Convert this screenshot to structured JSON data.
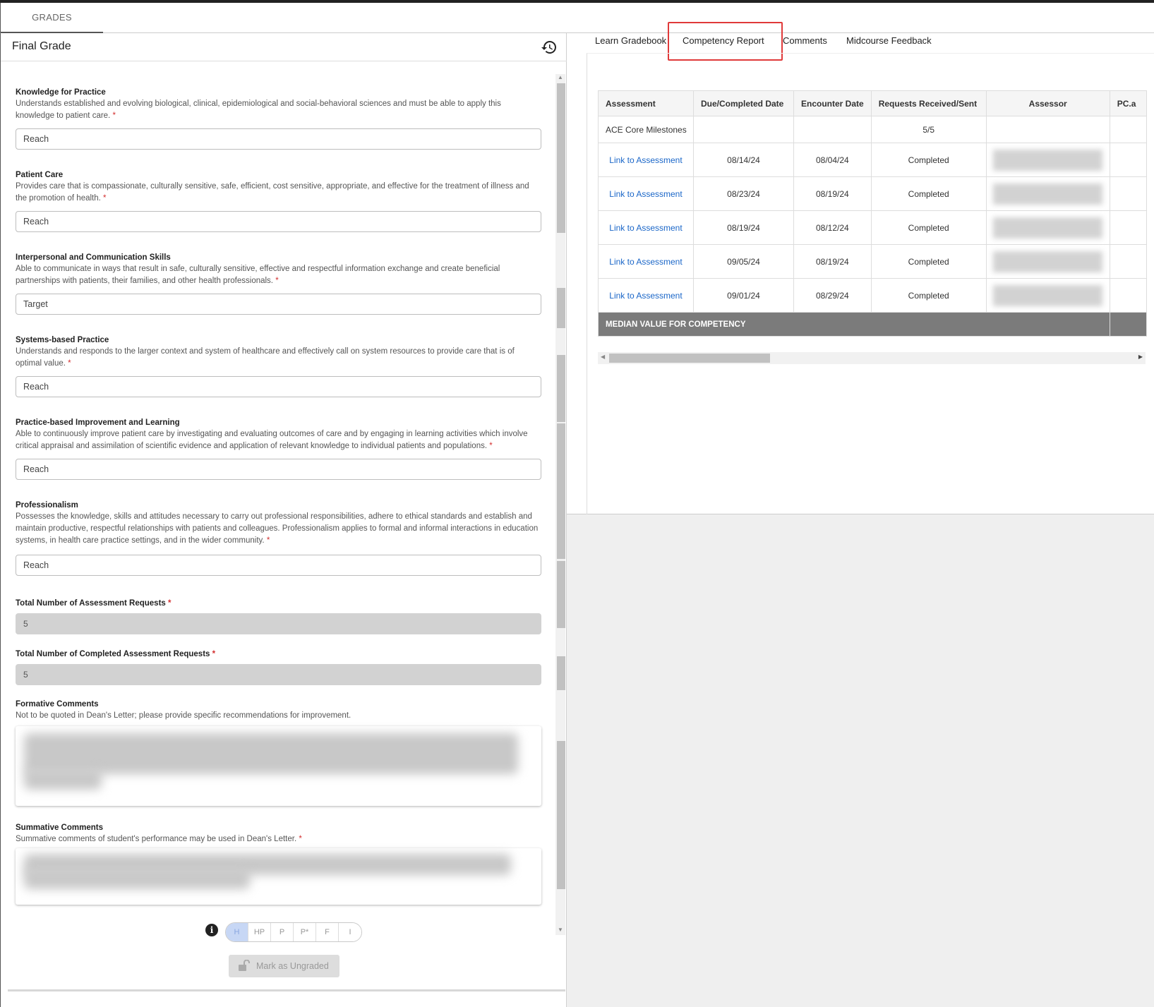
{
  "tabs": {
    "grades": "GRADES"
  },
  "final_grade": {
    "title": "Final Grade",
    "competencies": [
      {
        "label": "Knowledge for Practice",
        "description": "Understands established and evolving biological, clinical, epidemiological and social-behavioral sciences and must be able to apply this knowledge to patient care.",
        "value": "Reach"
      },
      {
        "label": "Patient Care",
        "description": "Provides care that is compassionate, culturally sensitive, safe, efficient, cost sensitive, appropriate, and effective for the treatment of illness and the promotion of health.",
        "value": "Reach"
      },
      {
        "label": "Interpersonal and Communication Skills",
        "description": "Able to communicate in ways that result in safe, culturally sensitive, effective and respectful information exchange and create beneficial partnerships with patients, their families, and other health professionals.",
        "value": "Target"
      },
      {
        "label": "Systems-based Practice",
        "description": "Understands and responds to the larger context and system of healthcare and effectively call on system resources to provide care that is of optimal value.",
        "value": "Reach"
      },
      {
        "label": "Practice-based Improvement and Learning",
        "description": "Able to continuously improve patient care by investigating and evaluating outcomes of care and by engaging in learning activities which involve critical appraisal and assimilation of scientific evidence and application of relevant knowledge to individual patients and populations.",
        "value": "Reach"
      },
      {
        "label": "Professionalism",
        "description": "Possesses the knowledge, skills and attitudes necessary to carry out professional responsibilities, adhere to ethical standards and establish and maintain productive, respectful relationships with patients and colleagues. Professionalism applies to formal and informal interactions in education systems, in health care practice settings, and in the wider community.",
        "value": "Reach"
      }
    ],
    "total_requests": {
      "label": "Total Number of Assessment Requests",
      "value": "5"
    },
    "completed_requests": {
      "label": "Total Number of Completed Assessment Requests",
      "value": "5"
    },
    "formative": {
      "label": "Formative Comments",
      "description": "Not to be quoted in Dean's Letter; please provide specific recommendations for improvement."
    },
    "summative": {
      "label": "Summative Comments",
      "description": "Summative comments of student's performance may be used in Dean's Letter."
    },
    "required_mark": "*",
    "grades": [
      "H",
      "HP",
      "P",
      "P*",
      "F",
      "I"
    ],
    "selected_grade": "H",
    "ungraded_label": "Mark as Ungraded"
  },
  "right_tabs": [
    "Learn Gradebook",
    "Competency Report",
    "Comments",
    "Midcourse Feedback"
  ],
  "active_right_tab": "Competency Report",
  "report": {
    "columns": [
      "Assessment",
      "Due/Completed Date",
      "Encounter Date",
      "Requests Received/Sent",
      "Assessor",
      "PC.a"
    ],
    "group_row": {
      "assessment": "ACE Core Milestones",
      "requests": "5/5"
    },
    "rows": [
      {
        "assessment": "Link to Assessment",
        "due": "08/14/24",
        "encounter": "08/04/24",
        "status": "Completed"
      },
      {
        "assessment": "Link to Assessment",
        "due": "08/23/24",
        "encounter": "08/19/24",
        "status": "Completed"
      },
      {
        "assessment": "Link to Assessment",
        "due": "08/19/24",
        "encounter": "08/12/24",
        "status": "Completed"
      },
      {
        "assessment": "Link to Assessment",
        "due": "09/05/24",
        "encounter": "08/19/24",
        "status": "Completed"
      },
      {
        "assessment": "Link to Assessment",
        "due": "09/01/24",
        "encounter": "08/29/24",
        "status": "Completed"
      }
    ],
    "median_label": "MEDIAN VALUE FOR COMPETENCY"
  },
  "colors": {
    "accent": "#1a66c8",
    "required": "#d32f2f",
    "highlight": "#e03a3a",
    "median_bg": "#7b7b7b"
  }
}
